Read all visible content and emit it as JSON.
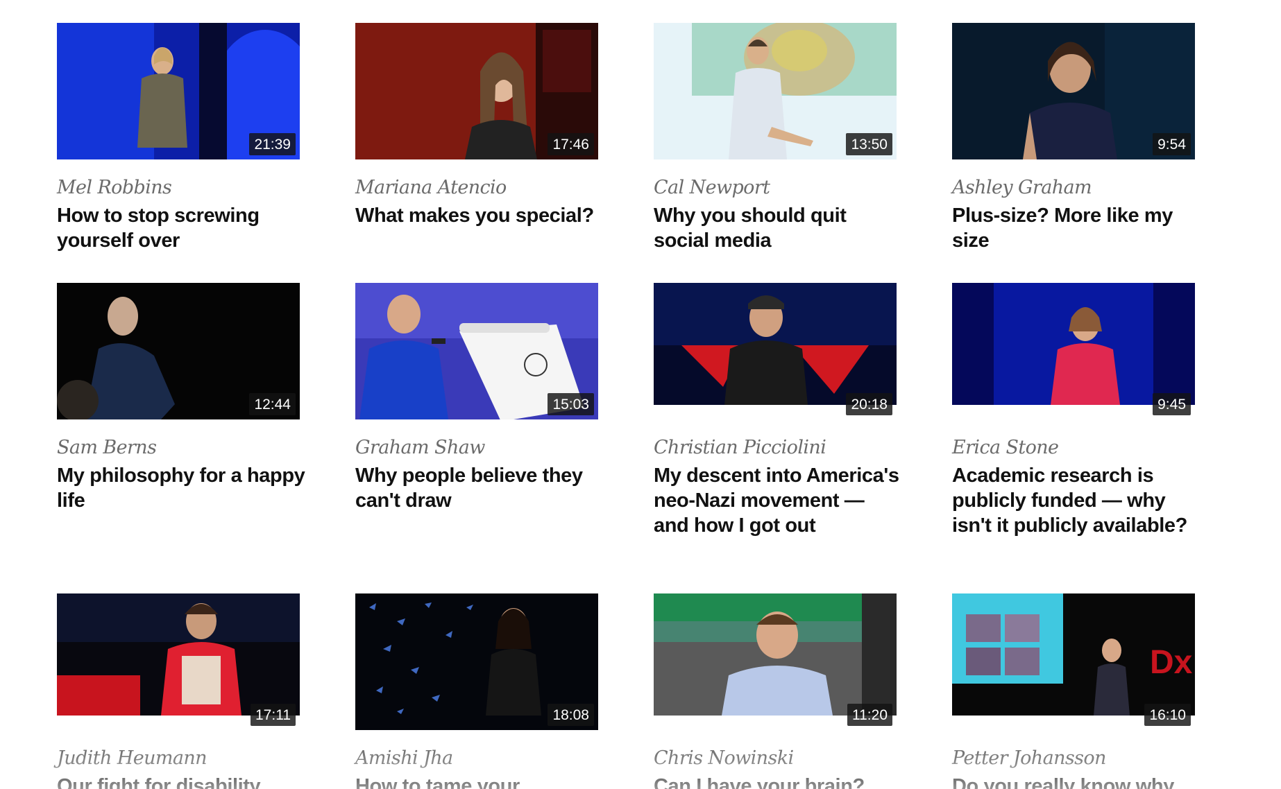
{
  "talks": [
    {
      "speaker": "Mel Robbins",
      "title": "How to stop screwing yourself over",
      "duration": "21:39",
      "thumb_colors": [
        "#1230c8",
        "#0a1a7a"
      ]
    },
    {
      "speaker": "Mariana Atencio",
      "title": "What makes you special?",
      "duration": "17:46",
      "thumb_colors": [
        "#8a1c12",
        "#3a0d08"
      ]
    },
    {
      "speaker": "Cal Newport",
      "title": "Why you should quit social media",
      "duration": "13:50",
      "thumb_colors": [
        "#cfe8f0",
        "#9fd0c0"
      ]
    },
    {
      "speaker": "Ashley Graham",
      "title": "Plus-size? More like my size",
      "duration": "9:54",
      "thumb_colors": [
        "#0a1f33",
        "#050d18"
      ]
    },
    {
      "speaker": "Sam Berns",
      "title": "My philosophy for a happy life",
      "duration": "12:44",
      "thumb_colors": [
        "#050505",
        "#101010"
      ]
    },
    {
      "speaker": "Graham Shaw",
      "title": "Why people believe they can't draw",
      "duration": "15:03",
      "thumb_colors": [
        "#4a4ad8",
        "#2a2a9a"
      ]
    },
    {
      "speaker": "Christian Picciolini",
      "title": "My descent into America's neo-Nazi movement — and how I got out",
      "duration": "20:18",
      "thumb_colors": [
        "#0a1440",
        "#c8141e"
      ]
    },
    {
      "speaker": "Erica Stone",
      "title": "Academic research is publicly funded — why isn't it publicly available?",
      "duration": "9:45",
      "thumb_colors": [
        "#0a1690",
        "#06084a"
      ]
    },
    {
      "speaker": "Judith Heumann",
      "title": "Our fight for disability",
      "duration": "17:11",
      "thumb_colors": [
        "#0a0a14",
        "#c8141e"
      ]
    },
    {
      "speaker": "Amishi Jha",
      "title": "How to tame your",
      "duration": "18:08",
      "thumb_colors": [
        "#05070f",
        "#3a6ad0"
      ]
    },
    {
      "speaker": "Chris Nowinski",
      "title": "Can I have your brain?",
      "duration": "11:20",
      "thumb_colors": [
        "#1f7a4a",
        "#6a6a6a"
      ]
    },
    {
      "speaker": "Petter Johansson",
      "title": "Do you really know why",
      "duration": "16:10",
      "thumb_colors": [
        "#0a0a0a",
        "#40c8e0"
      ]
    }
  ]
}
